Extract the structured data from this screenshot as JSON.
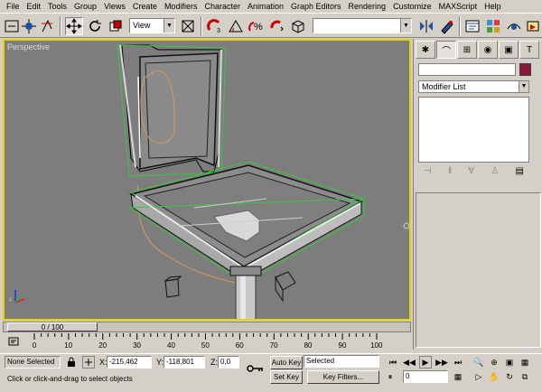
{
  "menu": [
    "File",
    "Edit",
    "Tools",
    "Group",
    "Views",
    "Create",
    "Modifiers",
    "Character",
    "Animation",
    "Graph Editors",
    "Rendering",
    "Customize",
    "MAXScript",
    "Help"
  ],
  "toolbar": {
    "view_label": "View",
    "selection_set_value": "",
    "icons": [
      "undo-icon",
      "redo-icon",
      "select-link-icon",
      "unlink-icon",
      "bind-space-warp-icon",
      "select-object-icon",
      "select-by-name-icon",
      "select-region-icon",
      "select-move-icon",
      "select-rotate-icon",
      "select-scale-icon",
      "reference-coord-dropdown",
      "pivot-center-icon",
      "manipulate-icon",
      "snap-toggle-icon",
      "angle-snap-icon",
      "percent-snap-icon",
      "spinner-snap-icon",
      "named-selection-icon",
      "mirror-icon",
      "align-icon",
      "schematic-view-icon",
      "material-editor-icon",
      "render-scene-icon",
      "quick-render-icon"
    ]
  },
  "viewport": {
    "label": "Perspective",
    "accent_color": "#e8d200",
    "background": "#7d7d7d"
  },
  "command_panel": {
    "tabs": [
      "create-tab",
      "modify-tab",
      "hierarchy-tab",
      "motion-tab",
      "display-tab",
      "utilities-tab"
    ],
    "object_name": "",
    "object_color": "#8b1738",
    "modifier_list_label": "Modifier List"
  },
  "timeline": {
    "slider_label": "0 / 100",
    "ticks": [
      "0",
      "10",
      "20",
      "30",
      "40",
      "50",
      "60",
      "70",
      "80",
      "90",
      "100"
    ]
  },
  "status": {
    "selection": "None Selected",
    "x_label": "X:",
    "x_value": "-215,462",
    "y_label": "Y:",
    "y_value": "-118,801",
    "z_label": "Z:",
    "z_value": "0,0",
    "auto_key": "Auto Key",
    "key_mode_value": "Selected",
    "set_key": "Set Key",
    "key_filters": "Key Filters...",
    "frame_value": "0",
    "prompt": "Click or click-and-drag to select objects"
  }
}
